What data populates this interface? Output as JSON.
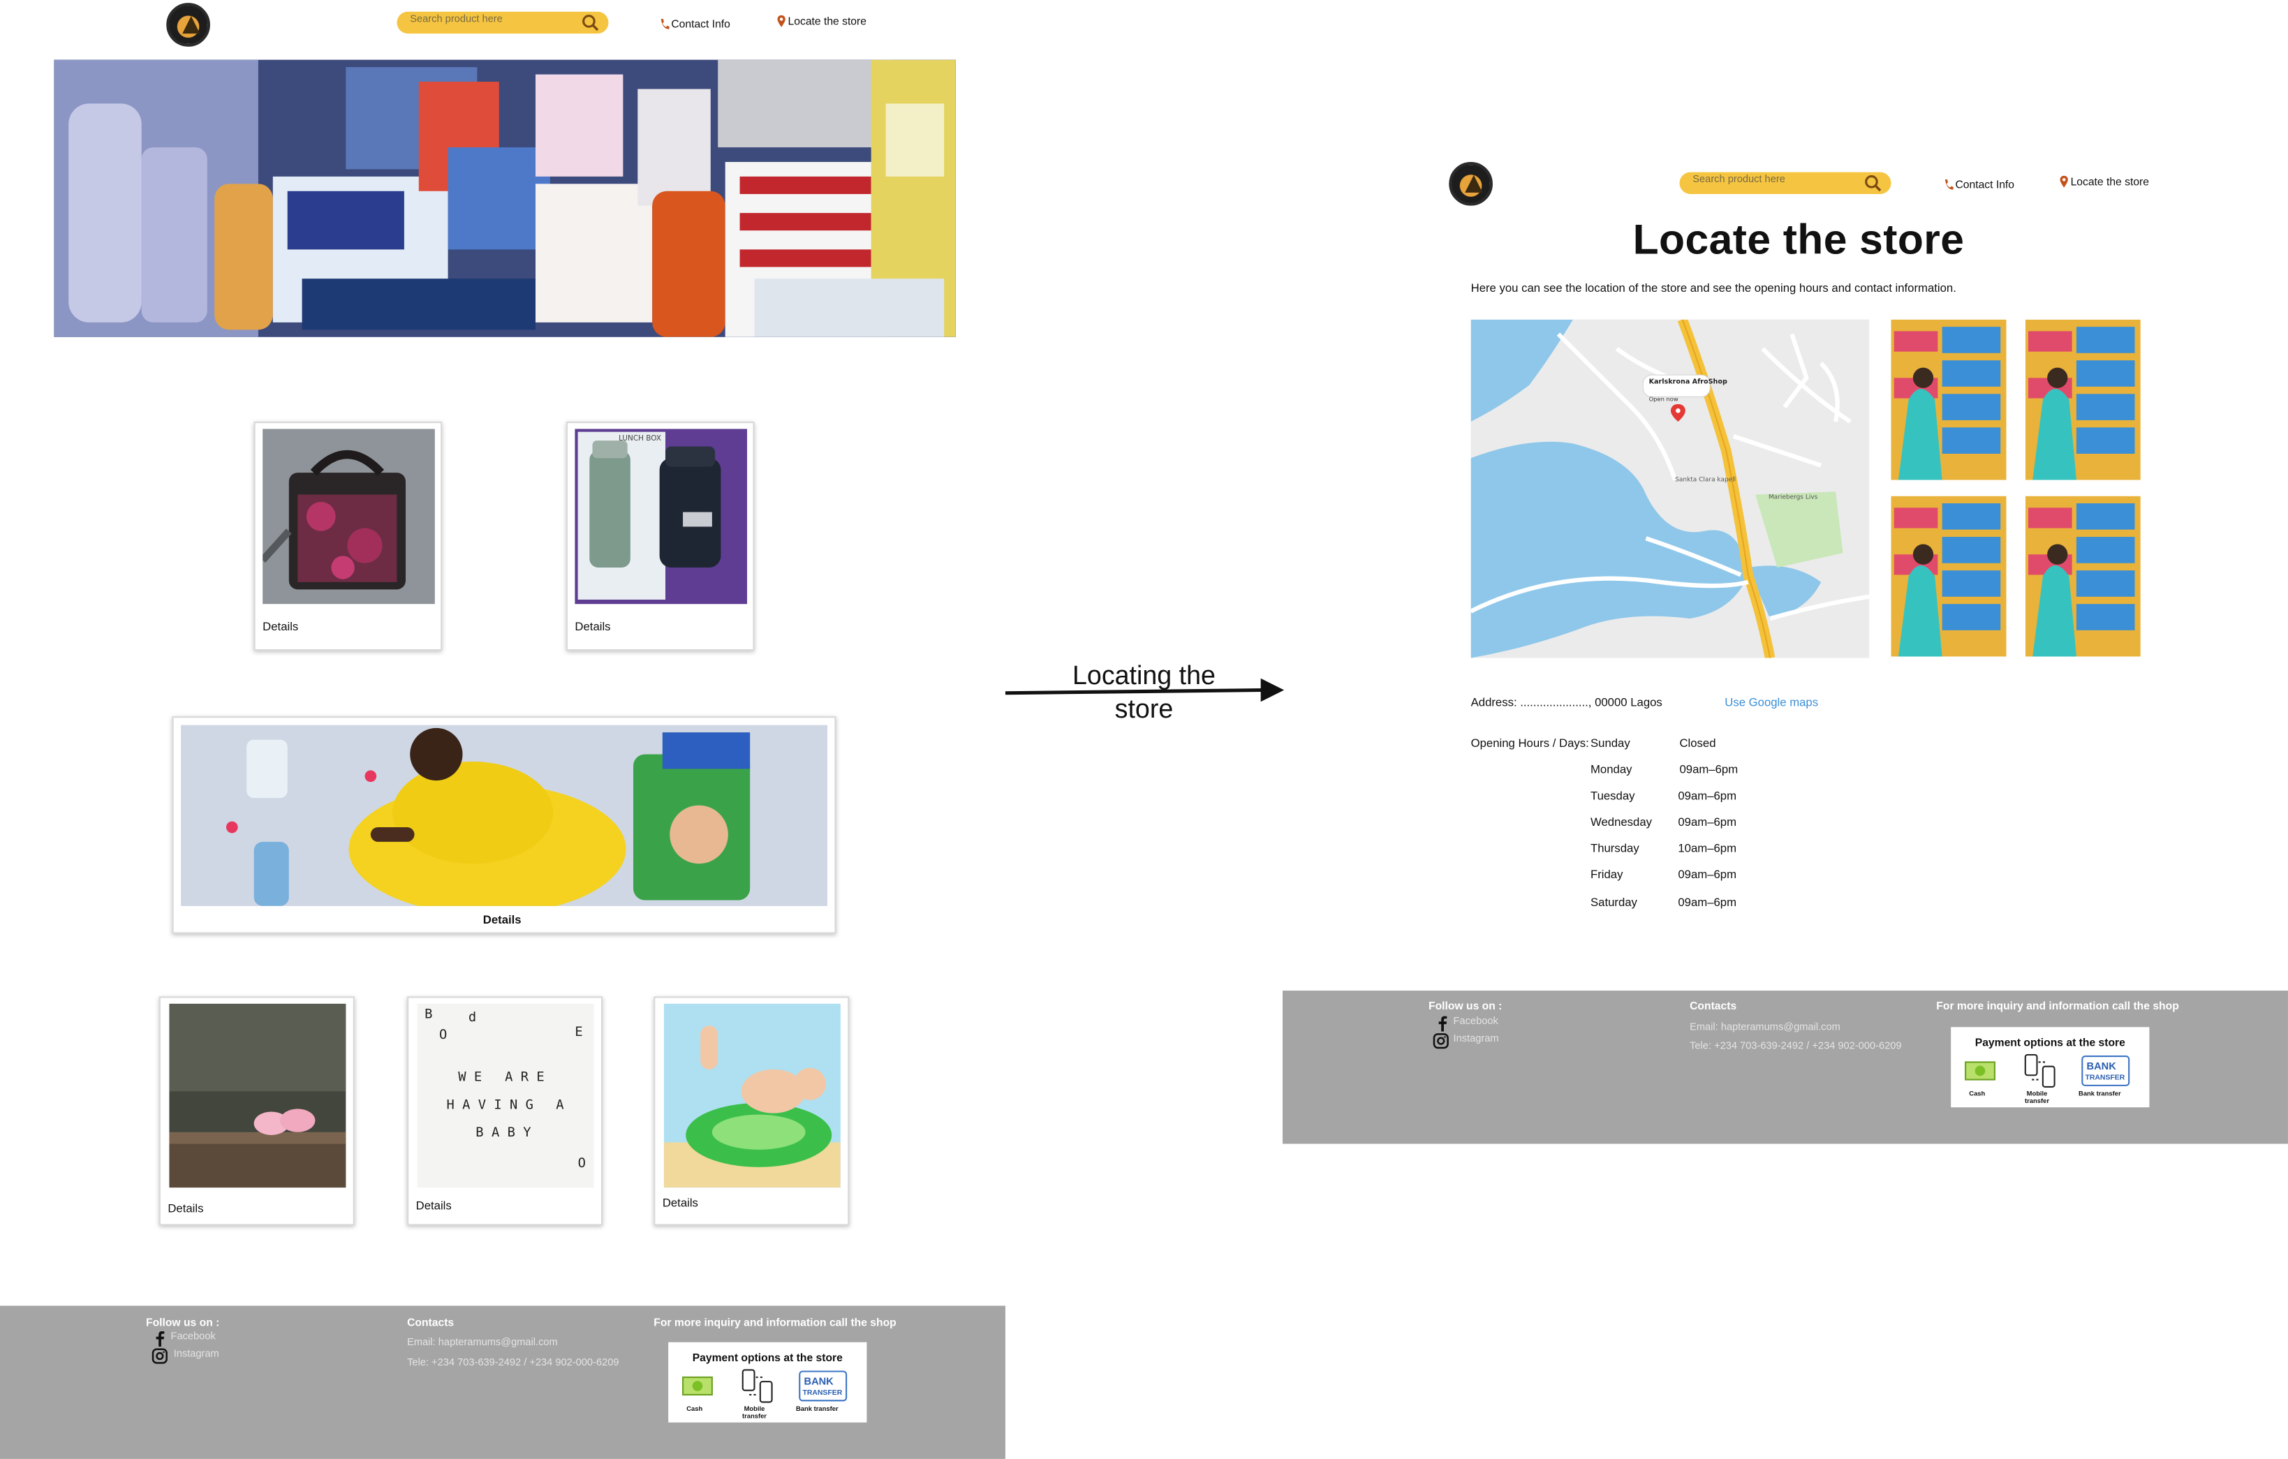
{
  "left_page": {
    "search": {
      "placeholder": "Search product here"
    },
    "nav": {
      "contact": "Contact Info",
      "locate": "Locate the store"
    },
    "cards": [
      {
        "label": "Details",
        "image": "cooler-bag"
      },
      {
        "label": "Details",
        "image": "lunch-box-flasks"
      },
      {
        "label": "Details",
        "image": "baby-products-banner"
      },
      {
        "label": "Details",
        "image": "baby-shoes"
      },
      {
        "label": "Details",
        "image": "we-are-having-a-baby"
      },
      {
        "label": "Details",
        "image": "baby-float"
      }
    ],
    "footer": {
      "follow_title": "Follow us on :",
      "facebook": "Facebook",
      "instagram": "Instagram",
      "contacts_title": "Contacts",
      "email": "Email: hapteramums@gmail.com",
      "tele": "Tele: +234 703-639-2492 / +234 902-000-6209",
      "inquiry_title": "For more inquiry and information call the shop",
      "payment_title": "Payment options at the store",
      "payment_options": [
        "Cash",
        "Mobile transfer",
        "Bank transfer"
      ]
    }
  },
  "arrow": {
    "label_line1": "Locating the",
    "label_line2": "store"
  },
  "right_page": {
    "search": {
      "placeholder": "Search product here"
    },
    "nav": {
      "contact": "Contact Info",
      "locate": "Locate the store"
    },
    "title": "Locate the store",
    "intro": "Here you can see the location of the store and see the opening hours and contact information.",
    "map": {
      "place_name": "Karlskrona AfroShop",
      "place_status": "Open now",
      "labels": [
        "Sankta Clara kapell",
        "Mariebergs Livs"
      ]
    },
    "address_label": "Address: ....................., 00000 Lagos",
    "google_maps_link": "Use Google maps",
    "hours_label": "Opening Hours / Days:",
    "hours": [
      {
        "day": "Sunday",
        "time": "Closed"
      },
      {
        "day": "Monday",
        "time": "09am–6pm"
      },
      {
        "day": "Tuesday",
        "time": "09am–6pm"
      },
      {
        "day": "Wednesday",
        "time": "09am–6pm"
      },
      {
        "day": "Thursday",
        "time": "10am–6pm"
      },
      {
        "day": "Friday",
        "time": "09am–6pm"
      },
      {
        "day": "Saturday",
        "time": "09am–6pm"
      }
    ],
    "footer": {
      "follow_title": "Follow us on :",
      "facebook": "Facebook",
      "instagram": "Instagram",
      "contacts_title": "Contacts",
      "email": "Email: hapteramums@gmail.com",
      "tele": "Tele: +234 703-639-2492 / +234 902-000-6209",
      "inquiry_title": "For more inquiry and information call the shop",
      "payment_title": "Payment options at the store",
      "payment_options": [
        "Cash",
        "Mobile transfer",
        "Bank transfer"
      ]
    }
  },
  "colors": {
    "search_yellow": "#f5c542",
    "footer_gray": "#a5a5a5",
    "link_blue": "#3a8fd6",
    "map_water": "#8ec7ea",
    "map_road": "#f4c23a"
  }
}
